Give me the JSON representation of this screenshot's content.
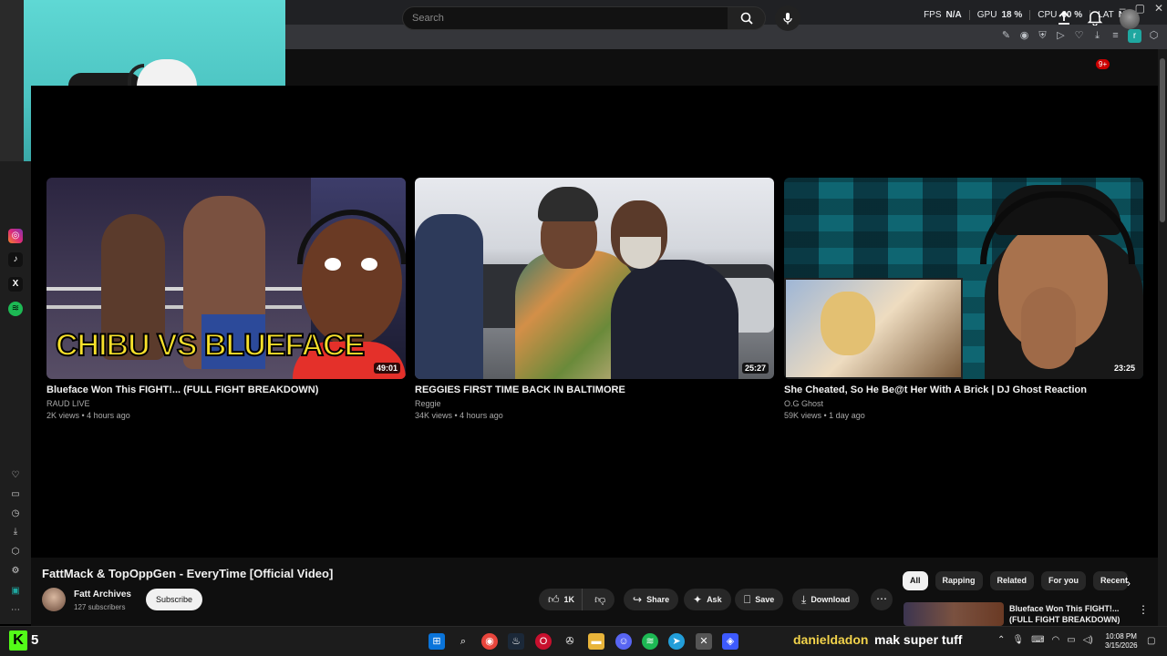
{
  "perf": {
    "fps_label": "FPS",
    "fps_value": "N/A",
    "gpu_label": "GPU",
    "gpu_value": "18 %",
    "cpu_label": "CPU",
    "cpu_value": "60 %",
    "lat_label": "LAT",
    "lat_value": "N/A"
  },
  "header": {
    "search_placeholder": "Search",
    "notif_badge": "9+"
  },
  "videos": [
    {
      "title": "Blueface Won This FIGHT!... (FULL FIGHT BREAKDOWN)",
      "channel": "RAUD LIVE",
      "meta": "2K views • 4 hours ago",
      "duration": "49:01",
      "caption": "CHIBU VS BLUEFACE"
    },
    {
      "title": "REGGIES FIRST TIME BACK IN BALTIMORE",
      "channel": "Reggie",
      "meta": "34K views • 4 hours ago",
      "duration": "25:27"
    },
    {
      "title": "She Cheated, So He Be@t Her With A Brick | DJ Ghost Reaction",
      "channel": "O.G Ghost",
      "meta": "59K views • 1 day ago",
      "duration": "23:25"
    }
  ],
  "player": {
    "title": "FattMack & TopOppGen - EveryTime [Official Video]",
    "channel": "Fatt Archives",
    "subs": "127 subscribers",
    "subscribe": "Subscribe",
    "likes": "1K",
    "share": "Share",
    "ask": "Ask",
    "save": "Save",
    "download": "Download"
  },
  "chips": [
    "All",
    "Rapping",
    "Related",
    "For you",
    "Recent"
  ],
  "upnext": {
    "title": "Blueface Won This FIGHT!... (FULL FIGHT BREAKDOWN)"
  },
  "taskbar": {
    "kick_count": "5",
    "chat_user": "danieldadon",
    "chat_msg": "mak super tuff",
    "time": "10:08 PM",
    "date": "3/15/2026"
  }
}
